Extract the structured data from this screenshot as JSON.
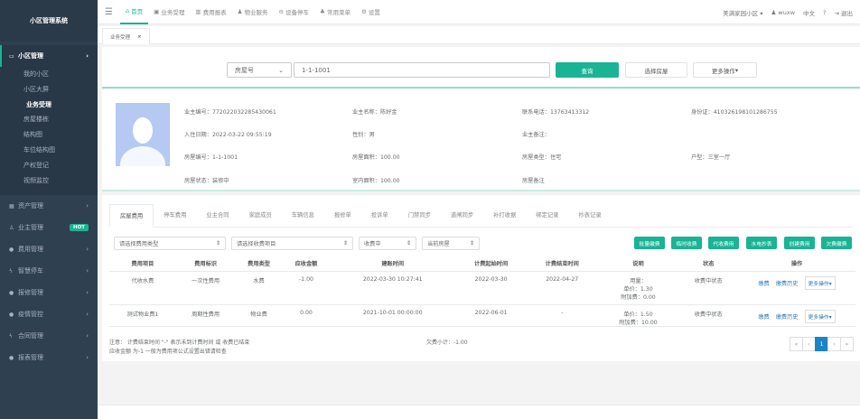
{
  "app": {
    "title": "小区管理系统"
  },
  "sidebar": {
    "group": "小区管理",
    "sub": [
      "我的小区",
      "小区大屏",
      "业务受理",
      "房屋楼栋",
      "结构图",
      "车位结构图",
      "产权登记",
      "视频监控"
    ],
    "menus": [
      "资产管理",
      "业主管理",
      "费用管理",
      "智慧停车",
      "报修管理",
      "疫情管控",
      "合同管理",
      "报表管理"
    ],
    "hot": "HOT"
  },
  "topnav": {
    "items": [
      "首页",
      "业务受理",
      "费用报表",
      "物业服务",
      "设备停车",
      "常用菜单",
      "设置"
    ],
    "community": "美满家园小区",
    "user": "wuxw",
    "lang": "中文",
    "help": "?",
    "logout": "退出"
  },
  "tab": {
    "label": "业务受理",
    "close": "×"
  },
  "search": {
    "type": "房屋号",
    "value": "1-1-1001",
    "query": "查询",
    "choose": "选择房屋",
    "more": "更多操作"
  },
  "owner": {
    "l_id": "业主编号：",
    "id": "772022032285430061",
    "l_name": "业主名称：",
    "name": "陈好金",
    "l_phone": "联系电话：",
    "phone": "13763413312",
    "l_idcard": "身份证：",
    "idcard": "410326198101286755",
    "l_date": "入住日期：",
    "date": "2022-03-22 09:55:19",
    "l_sex": "性别：",
    "sex": "男",
    "l_remark": "业主备注：",
    "l_room": "房屋编号：",
    "room": "1-1-1001",
    "l_area": "房屋面积：",
    "area": "100.00",
    "l_rtype": "房屋类型：",
    "rtype": "住宅",
    "l_layout": "户型：",
    "layout": "三室一厅",
    "l_status": "房屋状态：",
    "status": "装修中",
    "l_inner": "室内面积：",
    "inner": "100.00",
    "l_rremark": "房屋备注"
  },
  "fees": {
    "tabs": [
      "房屋费用",
      "停车费用",
      "业主合同",
      "家庭成员",
      "车辆信息",
      "报修单",
      "投诉单",
      "门禁同步",
      "道闸同步",
      "补打收据",
      "绑定记录",
      "抄表记录"
    ],
    "filters": [
      "请选择费用类型",
      "请选择收费项目",
      "收费中",
      "当前房屋"
    ],
    "buttons": [
      "批量缴费",
      "临时收费",
      "代收费用",
      "水电抄表",
      "创建费用",
      "欠费缴费"
    ],
    "columns": [
      "费用项目",
      "费用标识",
      "费用类型",
      "应收金额",
      "建账时间",
      "计费起始时间",
      "计费结束时间",
      "说明",
      "状态",
      "操作"
    ],
    "rows": [
      {
        "item": "代收水费",
        "flag": "一次性费用",
        "type": "水费",
        "amount": "-1.00",
        "created": "2022-03-30 10:27:41",
        "start": "2022-03-30",
        "end": "2022-04-27",
        "desc": [
          "用量：",
          "单价：1.30",
          "附加费：0.00"
        ],
        "status": "收费中状态"
      },
      {
        "item": "测试物业费1",
        "flag": "周期性费用",
        "type": "物业费",
        "amount": "0.00",
        "created": "2021-10-01 00:00:00",
        "start": "2022-06-01",
        "end": "-",
        "desc": [
          "单价：1.50",
          "附加费：10.00"
        ],
        "status": "收费中状态"
      }
    ],
    "ops": {
      "pay": "缴费",
      "history": "缴费历史",
      "more": "更多操作"
    },
    "note1": "注意：  计费结束时间  \"-\"  表示未到计费时间 或 收费已结束",
    "note2": "应收金额 为-1 一般为费用项公式设置出错请检查",
    "owe": "欠费小计：-1.00",
    "pager": [
      "«",
      "‹",
      "1",
      "›",
      "»"
    ]
  }
}
